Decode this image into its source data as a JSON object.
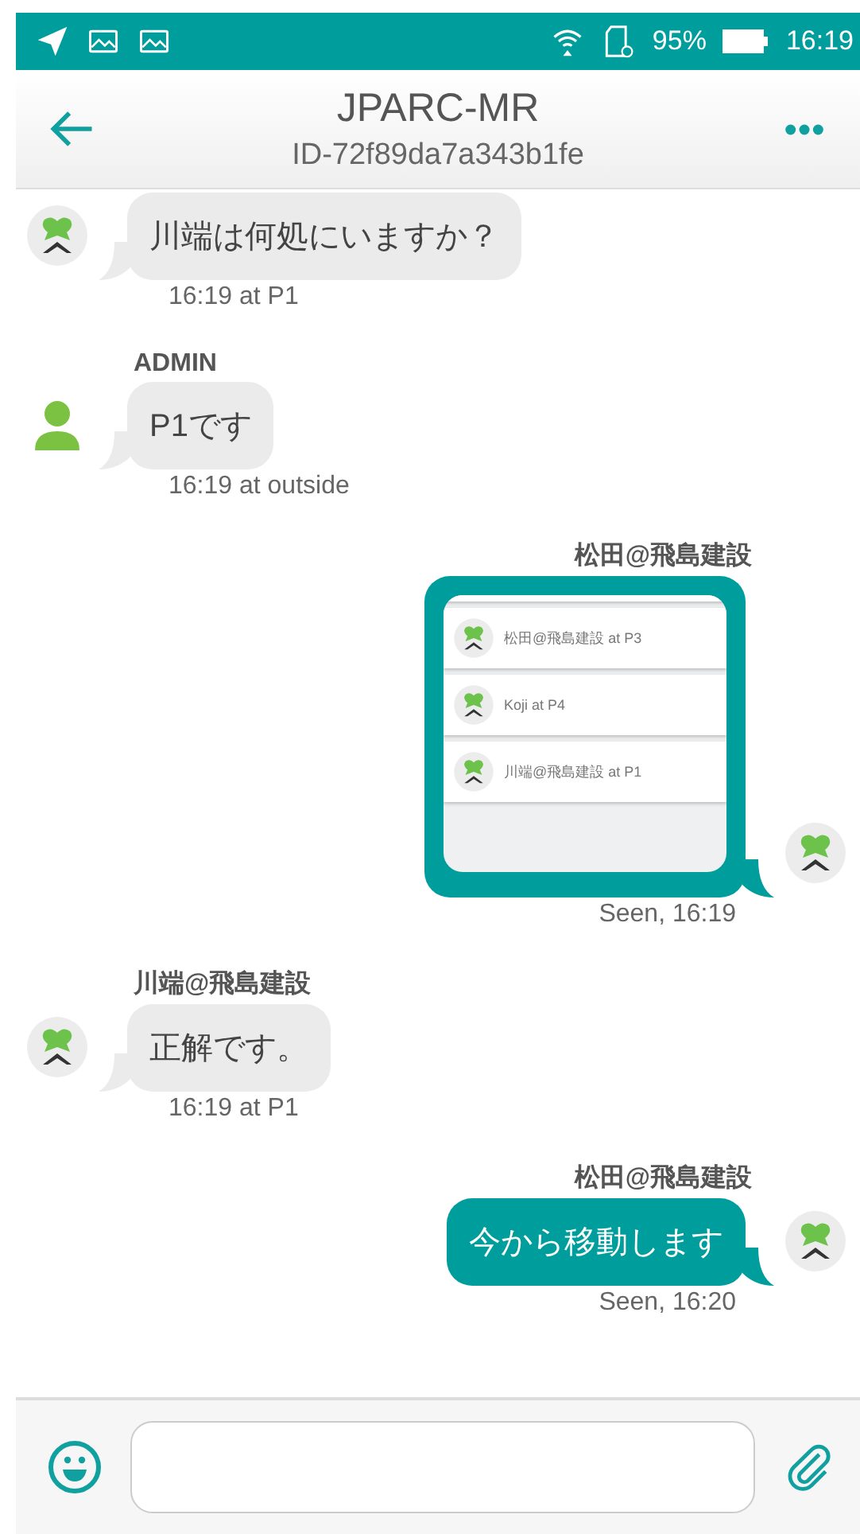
{
  "status_bar": {
    "battery": "95%",
    "time": "16:19"
  },
  "header": {
    "title": "JPARC-MR",
    "subtitle": "ID-72f89da7a343b1fe"
  },
  "messages": [
    {
      "kind": "text",
      "outgoing": false,
      "avatar": {
        "kind": "logo"
      },
      "text": "川端は何処にいますか？",
      "meta": "16:19 at P1"
    },
    {
      "kind": "text",
      "outgoing": false,
      "avatar": {
        "kind": "person"
      },
      "sender": "ADMIN",
      "text": "P1です",
      "meta": "16:19 at outside"
    },
    {
      "kind": "image",
      "outgoing": true,
      "avatar": {
        "kind": "logo"
      },
      "sender": "松田@飛島建設",
      "items": [
        "松田@飛島建設 at P3",
        "Koji at P4",
        "川端@飛島建設 at P1"
      ],
      "meta": "Seen, 16:19"
    },
    {
      "kind": "text",
      "outgoing": false,
      "avatar": {
        "kind": "logo"
      },
      "sender": "川端@飛島建設",
      "text": "正解です。",
      "meta": "16:19 at P1"
    },
    {
      "kind": "text",
      "outgoing": true,
      "avatar": {
        "kind": "logo"
      },
      "sender": "松田@飛島建設",
      "text": "今から移動します",
      "meta": "Seen, 16:20"
    }
  ]
}
